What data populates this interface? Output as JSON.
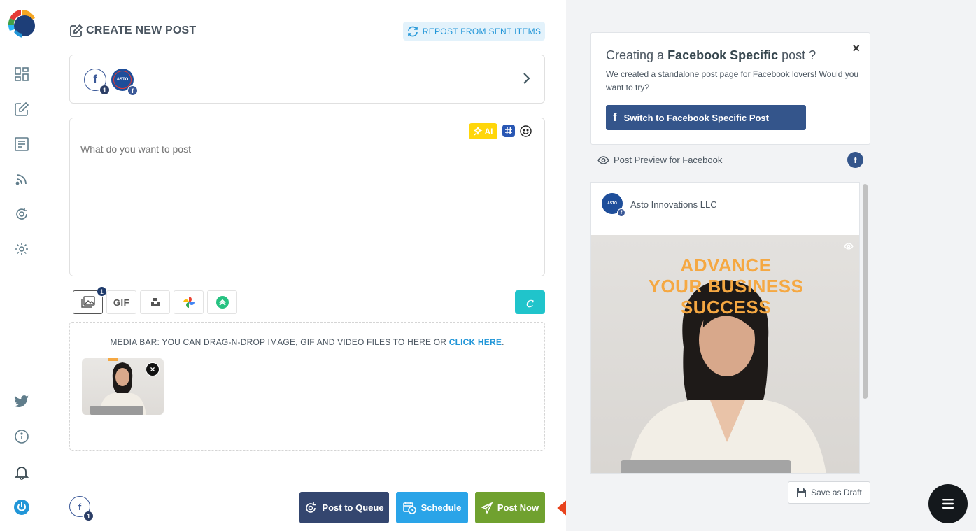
{
  "composer": {
    "title": "CREATE NEW POST",
    "repost_label": "REPOST FROM SENT ITEMS",
    "accounts": {
      "fb_badge_count": "1",
      "asto_logo_text": "ASTO"
    },
    "editor": {
      "placeholder": "What do you want to post",
      "ai_label": "AI"
    },
    "media_tools": {
      "images_badge": "1",
      "gif_label": "GIF"
    },
    "media_bar": {
      "text": "MEDIA BAR: YOU CAN DRAG-N-DROP IMAGE, GIF AND VIDEO FILES TO HERE OR ",
      "link": "CLICK HERE",
      "suffix": ".",
      "thumb_remove": "×"
    },
    "footer": {
      "fb_badge_count": "1",
      "post_to_queue": "Post to Queue",
      "schedule": "Schedule",
      "post_now": "Post Now"
    }
  },
  "right_panel": {
    "fb_card": {
      "title_prefix": "Creating a ",
      "title_bold": "Facebook Specific",
      "title_suffix": " post ?",
      "close": "×",
      "description": "We created a standalone post page for Facebook lovers! Would you want to try?",
      "switch_label": "Switch to Facebook Specific Post"
    },
    "preview": {
      "label": "Post Preview for Facebook",
      "account_name": "Asto Innovations LLC",
      "avatar_text": "ASTO",
      "headline": [
        "ADVANCE",
        "YOUR BUSINESS",
        "SUCCESS"
      ]
    },
    "save_draft": "Save as Draft"
  },
  "colors": {
    "facebook": "#3b5998",
    "queue_btn": "#34466f",
    "schedule_btn": "#2aa4e8",
    "post_now_btn": "#70a12f",
    "arrow": "#e8421c",
    "ai_btn": "#ffd60a",
    "canva_btn": "#20c4cb"
  }
}
